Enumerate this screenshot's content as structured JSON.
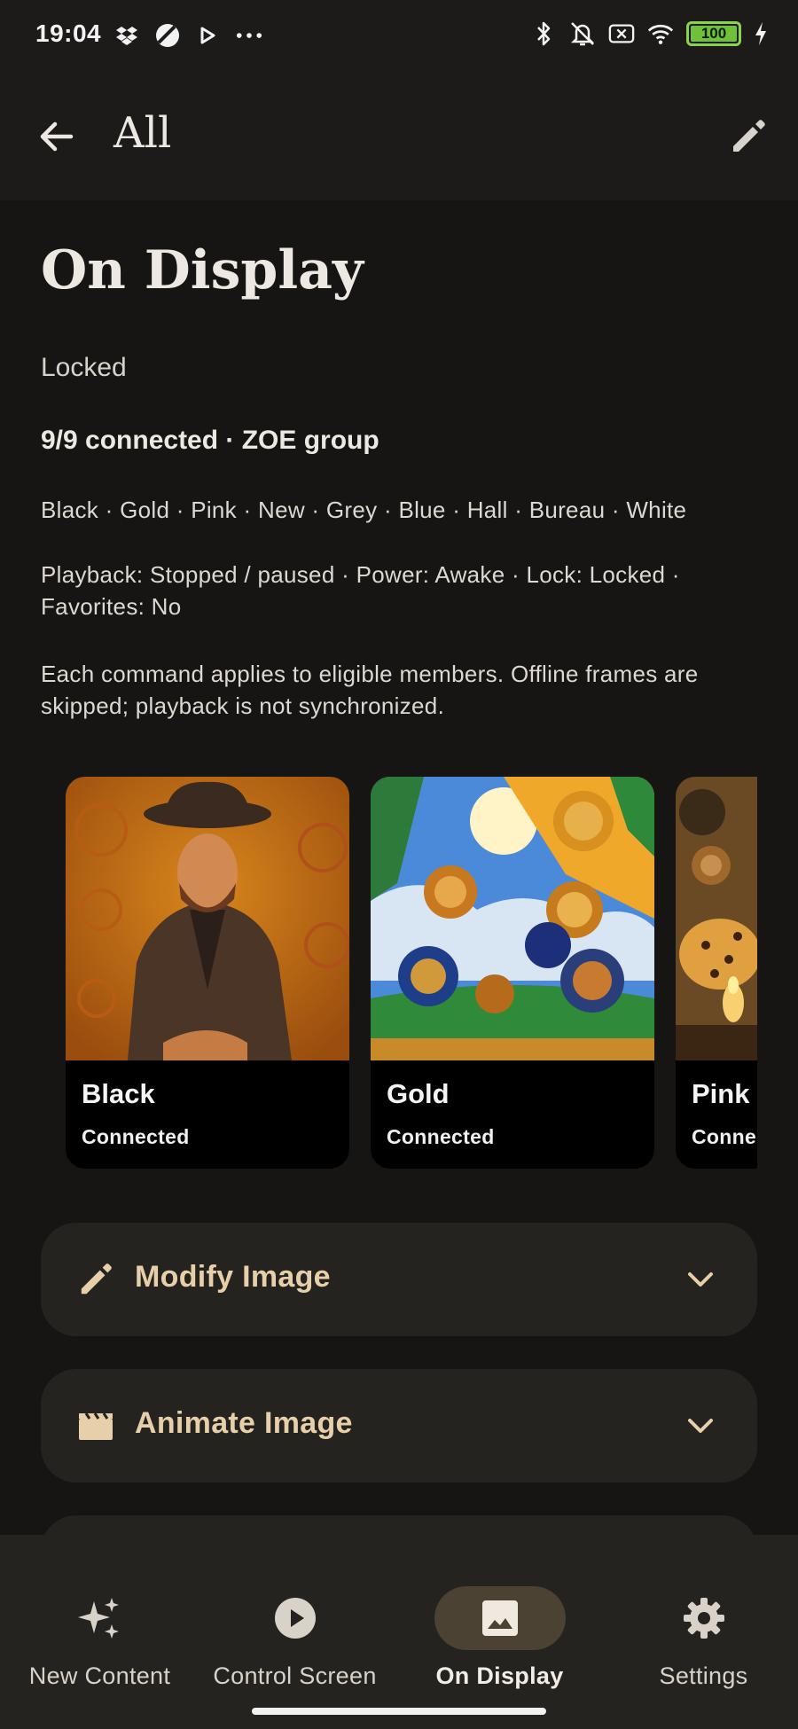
{
  "status_bar": {
    "time": "19:04",
    "battery_level": "100",
    "left_icons": [
      "dropbox-icon",
      "circle-slash-icon",
      "play-icon",
      "more-dots-icon"
    ],
    "right_icons": [
      "bluetooth-icon",
      "muted-bell-icon",
      "sim-off-icon",
      "wifi-icon",
      "battery-icon",
      "charging-icon"
    ]
  },
  "app_bar": {
    "title": "All",
    "back_icon": "arrow-left-icon",
    "action_icon": "pencil-icon"
  },
  "page": {
    "title": "On Display",
    "lock_status": "Locked",
    "group_summary": "9/9 connected · ZOE group",
    "members": "Black · Gold · Pink · New · Grey · Blue · Hall · Bureau · White",
    "state": "Playback: Stopped / paused · Power: Awake · Lock: Locked · Favorites: No",
    "note": "Each command applies to eligible members. Offline frames are skipped; playback is not synchronized."
  },
  "frames": [
    {
      "name": "Black",
      "status": "Connected",
      "image": "portrait-painting"
    },
    {
      "name": "Gold",
      "status": "Connected",
      "image": "lions-jungle-painting"
    },
    {
      "name": "Pink",
      "status": "Connected",
      "image": "leopard-monkeys-painting"
    }
  ],
  "sections": [
    {
      "label": "Modify Image",
      "icon": "pencil-icon"
    },
    {
      "label": "Animate Image",
      "icon": "clapperboard-icon"
    }
  ],
  "bottom_nav": {
    "items": [
      {
        "label": "New Content",
        "icon": "sparkles-icon",
        "active": false
      },
      {
        "label": "Control Screen",
        "icon": "play-circle-icon",
        "active": false
      },
      {
        "label": "On Display",
        "icon": "image-icon",
        "active": true
      },
      {
        "label": "Settings",
        "icon": "gear-icon",
        "active": false
      }
    ]
  },
  "colors": {
    "background": "#161514",
    "surface": "#25231f",
    "accent_text": "#e6cfa9",
    "active_pill": "#4b4234",
    "battery": "#6fc13a"
  }
}
